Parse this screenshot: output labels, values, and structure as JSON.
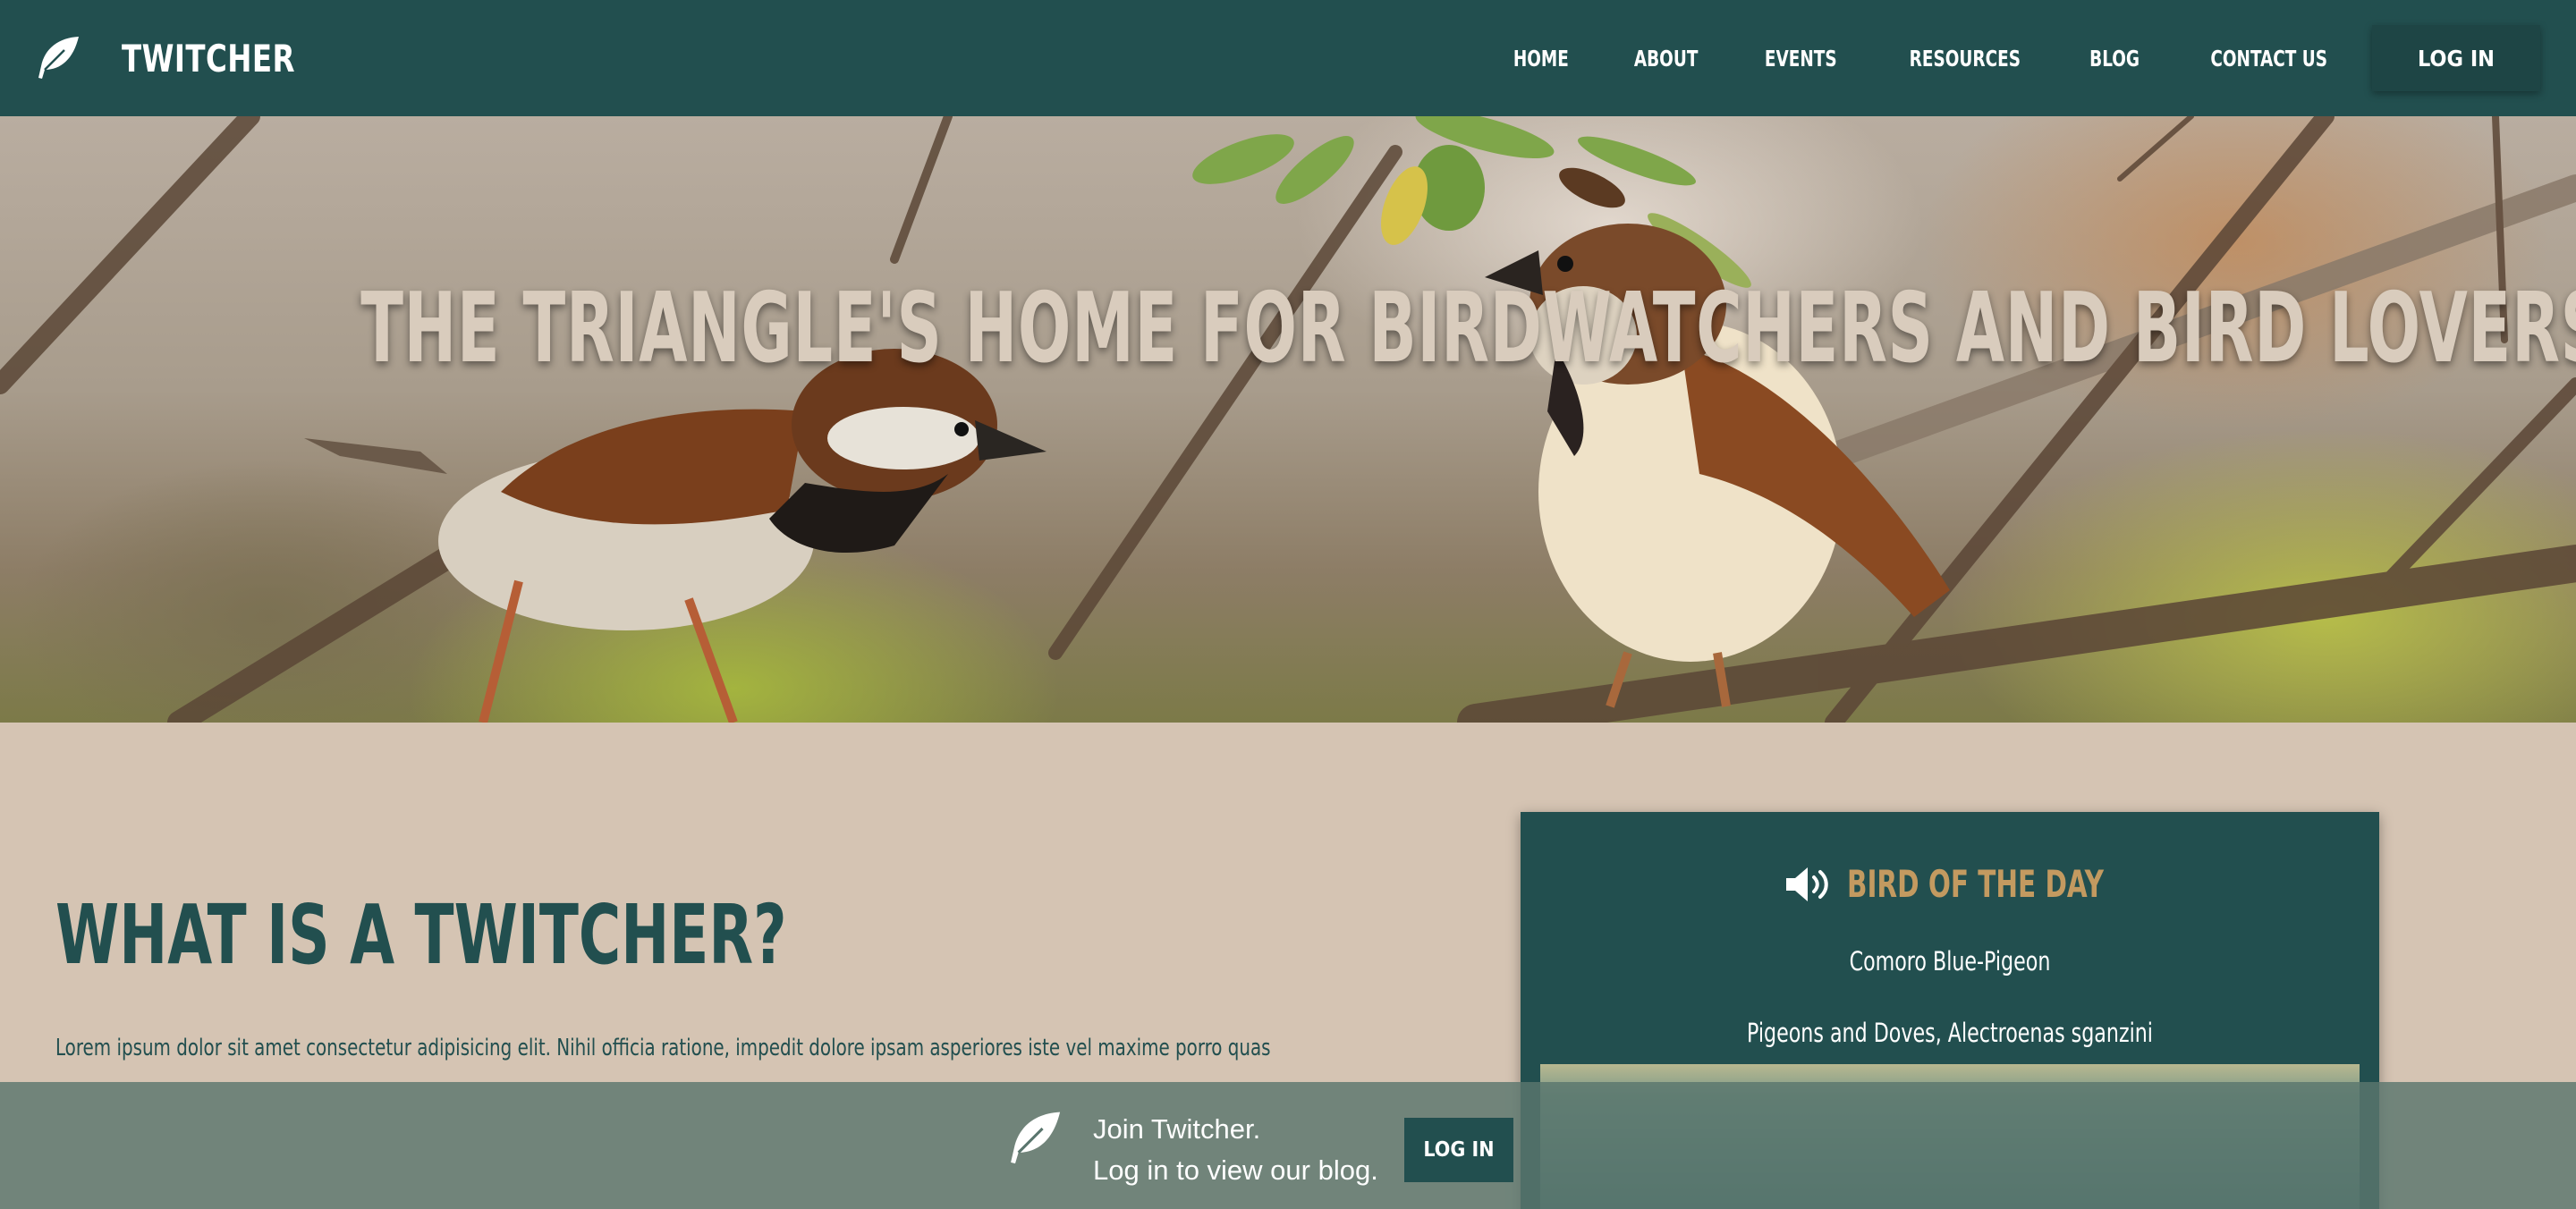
{
  "nav": {
    "brand": "TWITCHER",
    "links": [
      "HOME",
      "ABOUT",
      "EVENTS",
      "RESOURCES",
      "BLOG",
      "CONTACT US"
    ],
    "login": "LOG IN"
  },
  "hero": {
    "title": "THE TRIANGLE'S HOME FOR BIRDWATCHERS AND BIRD LOVERS"
  },
  "about": {
    "title": "WHAT IS A TWITCHER?",
    "text": "Lorem ipsum dolor sit amet consectetur adipisicing elit. Nihil officia ratione, impedit dolore ipsam asperiores iste vel maxime porro quas"
  },
  "bird_of_the_day": {
    "title": "BIRD OF THE DAY",
    "name": "Comoro Blue-Pigeon",
    "family": "Pigeons and Doves, Alectroenas sganzini"
  },
  "banner": {
    "line1": "Join Twitcher.",
    "line2": "Log in to view our blog.",
    "button": "LOG IN"
  },
  "colors": {
    "primary": "#224f4f",
    "background": "#d5c4b3",
    "accent": "#c39a60"
  },
  "icons": {
    "brand": "feather-icon",
    "audio": "speaker-icon"
  }
}
